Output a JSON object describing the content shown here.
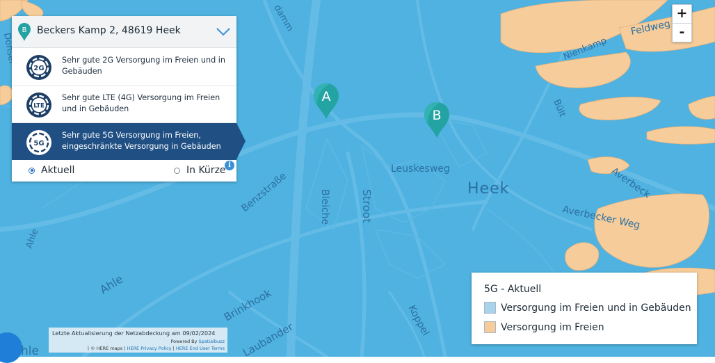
{
  "panel": {
    "address": "Beckers Kamp 2, 48619 Heek",
    "address_pin_letter": "B",
    "technologies": [
      {
        "badge": "2G",
        "description": "Sehr gute 2G Versorgung im Freien und in Gebäuden",
        "active": false
      },
      {
        "badge": "LTE",
        "description": "Sehr gute LTE (4G) Versorgung im Freien und in Gebäuden",
        "active": false
      },
      {
        "badge": "5G",
        "description": "Sehr gute 5G Versorgung im Freien, eingeschränkte Versorgung in Gebäuden",
        "active": true
      }
    ],
    "time_options": [
      {
        "label": "Aktuell",
        "selected": true
      },
      {
        "label": "In Kürze",
        "selected": false
      }
    ],
    "info_icon": "i"
  },
  "zoom": {
    "in_label": "+",
    "out_label": "-"
  },
  "legend": {
    "title": "5G - Aktuell",
    "items": [
      {
        "label": "Versorgung im Freien und in Gebäuden",
        "color": "#a9d3ea"
      },
      {
        "label": "Versorgung im Freien",
        "color": "#f6cd9a"
      }
    ]
  },
  "markers": [
    {
      "letter": "A"
    },
    {
      "letter": "B"
    }
  ],
  "map_labels": {
    "town": "Heek",
    "streets": [
      "Leuskesweg",
      "Stroot",
      "Bleiche",
      "Benzstraße",
      "Ahle",
      "Ahle",
      "Brinkhook",
      "Laubander",
      "Koppel",
      "Averbecker Weg",
      "Averbeck",
      "Bült",
      "Nienkamp",
      "Feldweg",
      "Donsel",
      "damm",
      "hle"
    ]
  },
  "attribution": {
    "updated": "Letzte Aktualisierung der Netzabdeckung am 09/02/2024",
    "powered_prefix": "Powered By",
    "powered_by": "Spatialbuzz",
    "copyright": "| © HERE maps |",
    "privacy": "HERE Privacy Policy",
    "separator": "|",
    "terms": "HERE End User Terms"
  },
  "colors": {
    "map_background": "#4fb2e0",
    "outdoor_coverage": "#f6cd9a",
    "road": "#66bde6",
    "marker": "#24a3a3",
    "active_row": "#1f4f83"
  }
}
